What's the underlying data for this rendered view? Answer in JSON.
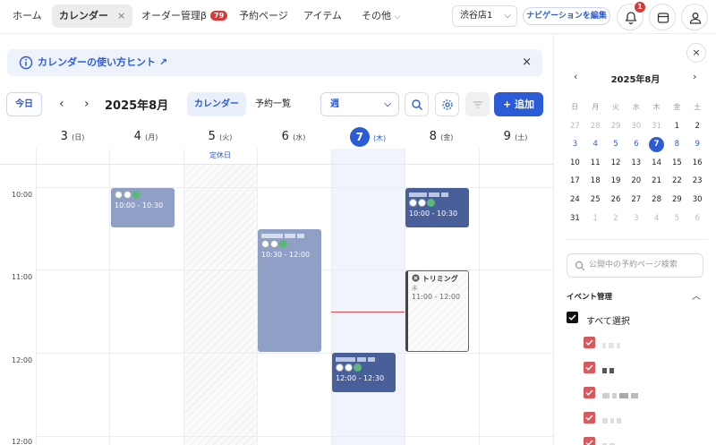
{
  "nav": {
    "items": [
      {
        "label": "ホーム"
      },
      {
        "label": "カレンダー",
        "close": "×"
      },
      {
        "label": "オーダー管理β",
        "badge": "79"
      },
      {
        "label": "予約ページ"
      },
      {
        "label": "アイテム"
      },
      {
        "label": "その他",
        "chev": "⌵"
      }
    ],
    "store": "渋谷店1",
    "store_chev": "⌵",
    "nav_edit": "ナビゲーションを編集",
    "notif_count": "1"
  },
  "hint": {
    "text": "カレンダーの使い方ヒント",
    "arrow": "↗",
    "close": "×"
  },
  "toolbar": {
    "today": "今日",
    "prev": "‹",
    "next": "›",
    "month": "2025年8月",
    "tab_calendar": "カレンダー",
    "tab_list": "予約一覧",
    "view": "週",
    "view_chev": "⌵",
    "add": "+ 追加"
  },
  "calendar": {
    "days": [
      {
        "num": "3",
        "dow": "(日)"
      },
      {
        "num": "4",
        "dow": "(月)"
      },
      {
        "num": "5",
        "dow": "(火)"
      },
      {
        "num": "6",
        "dow": "(水)"
      },
      {
        "num": "7",
        "dow": "(木)"
      },
      {
        "num": "8",
        "dow": "(金)"
      },
      {
        "num": "9",
        "dow": "(土)"
      }
    ],
    "closed_label": "定休日",
    "times": [
      "10:00",
      "11:00",
      "12:00",
      "12:00"
    ],
    "events": [
      {
        "time": "10:00 - 10:30"
      },
      {
        "time": "10:00 - 10:30"
      },
      {
        "time": "10:30 - 12:00"
      },
      {
        "time": "12:00 - 12:30"
      },
      {
        "title": "トリミング",
        "sub": "未",
        "time": "11:00 - 12:00"
      }
    ]
  },
  "sidebar": {
    "close": "×",
    "mini_prev": "‹",
    "mini_next": "›",
    "mini_title": "2025年8月",
    "dow": [
      "日",
      "月",
      "火",
      "水",
      "木",
      "金",
      "土"
    ],
    "weeks": [
      [
        "27",
        "28",
        "29",
        "30",
        "31",
        "1",
        "2"
      ],
      [
        "3",
        "4",
        "5",
        "6",
        "7",
        "8",
        "9"
      ],
      [
        "10",
        "11",
        "12",
        "13",
        "14",
        "15",
        "16"
      ],
      [
        "17",
        "18",
        "19",
        "20",
        "21",
        "22",
        "23"
      ],
      [
        "24",
        "25",
        "26",
        "27",
        "28",
        "29",
        "30"
      ],
      [
        "31",
        "1",
        "2",
        "3",
        "4",
        "5",
        "6"
      ]
    ],
    "search_placeholder": "公開中の予約ページ検索",
    "section": "イベント管理",
    "section_caret": "︿",
    "select_all": "すべて選択"
  }
}
